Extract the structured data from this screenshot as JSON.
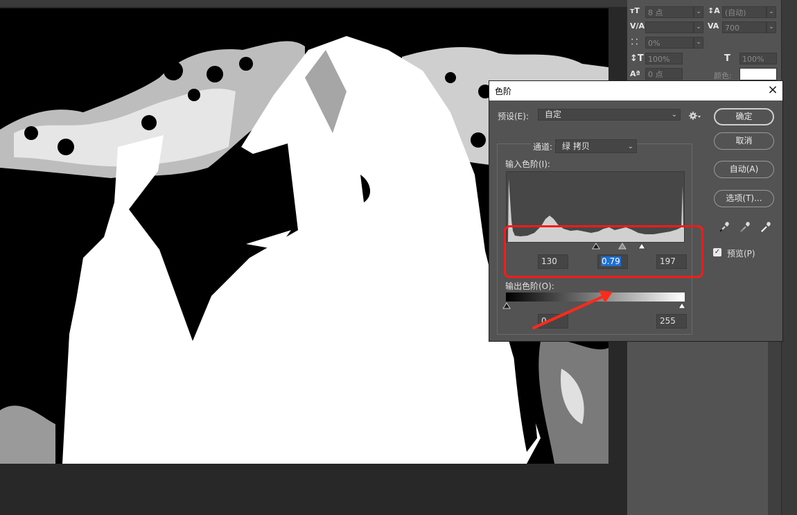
{
  "dialog": {
    "title": "色阶",
    "close_glyph": "×",
    "preset_label": "预设(E):",
    "preset_value": "自定",
    "channel_label": "通道:",
    "channel_value": "绿 拷贝",
    "input_levels_label": "输入色阶(I):",
    "input_black": "130",
    "input_gamma": "0.79",
    "input_white": "197",
    "output_levels_label": "输出色阶(O):",
    "output_black": "0",
    "output_white": "255",
    "buttons": {
      "ok": "确定",
      "cancel": "取消",
      "auto": "自动(A)",
      "options": "选项(T)..."
    },
    "preview_label": "预览(P)",
    "preview_checked": true,
    "eyedroppers": [
      "black-point-eyedropper-icon",
      "gray-point-eyedropper-icon",
      "white-point-eyedropper-icon"
    ],
    "gear_icon": "gear-icon"
  },
  "character_panel": {
    "font_size": "8 点",
    "leading": "(自动)",
    "tracking": "700",
    "tsume": "0%",
    "vertical_scale": "100%",
    "horizontal_scale": "100%",
    "baseline_shift": "0 点",
    "color_label": "颜色:",
    "icons": [
      "font-size-icon",
      "leading-icon",
      "kerning-icon",
      "tracking-icon",
      "tsume-icon",
      "vertical-scale-icon",
      "horizontal-scale-icon",
      "baseline-shift-icon"
    ]
  },
  "annotation": {
    "highlight_color": "#ff1a1a",
    "arrow_color": "#ff2a1a"
  }
}
